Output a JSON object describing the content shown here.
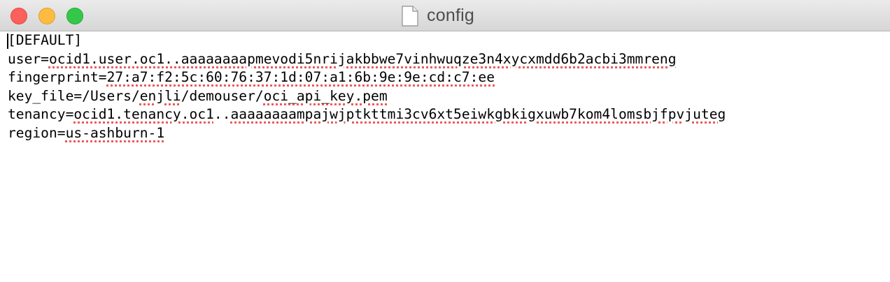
{
  "window": {
    "title": "config",
    "controls": {
      "close": "close",
      "minimize": "minimize",
      "zoom": "zoom"
    },
    "icon": "document-icon"
  },
  "editor": {
    "lines": [
      {
        "plain": "[DEFAULT]",
        "flagged": ""
      },
      {
        "plain": "user=",
        "flagged": "ocid1.user.oc1..aaaaaaaapmevodi5nrijakbbwe7vinhwuqze3n4xycxmdd6b2acbi3mmreng"
      },
      {
        "plain": "fingerprint=",
        "flagged": "27:a7:f2:5c:60:76:37:1d:07:a1:6b:9e:9e:cd:c7:ee"
      },
      {
        "plain": "key_file=/Users/",
        "flagged": "enjli",
        "plain2": "/demouser/",
        "flagged2": "oci_api_key.pem"
      },
      {
        "plain": "tenancy=",
        "flagged": "ocid1.tenancy.oc1",
        "plain2": "..",
        "flagged2": "aaaaaaaampajwjptkttmi3cv6xt5eiwkgbkigxuwb7kom4lomsbjfpvjuteg"
      },
      {
        "plain": "region=",
        "flagged": "us-ashburn-1"
      }
    ]
  }
}
